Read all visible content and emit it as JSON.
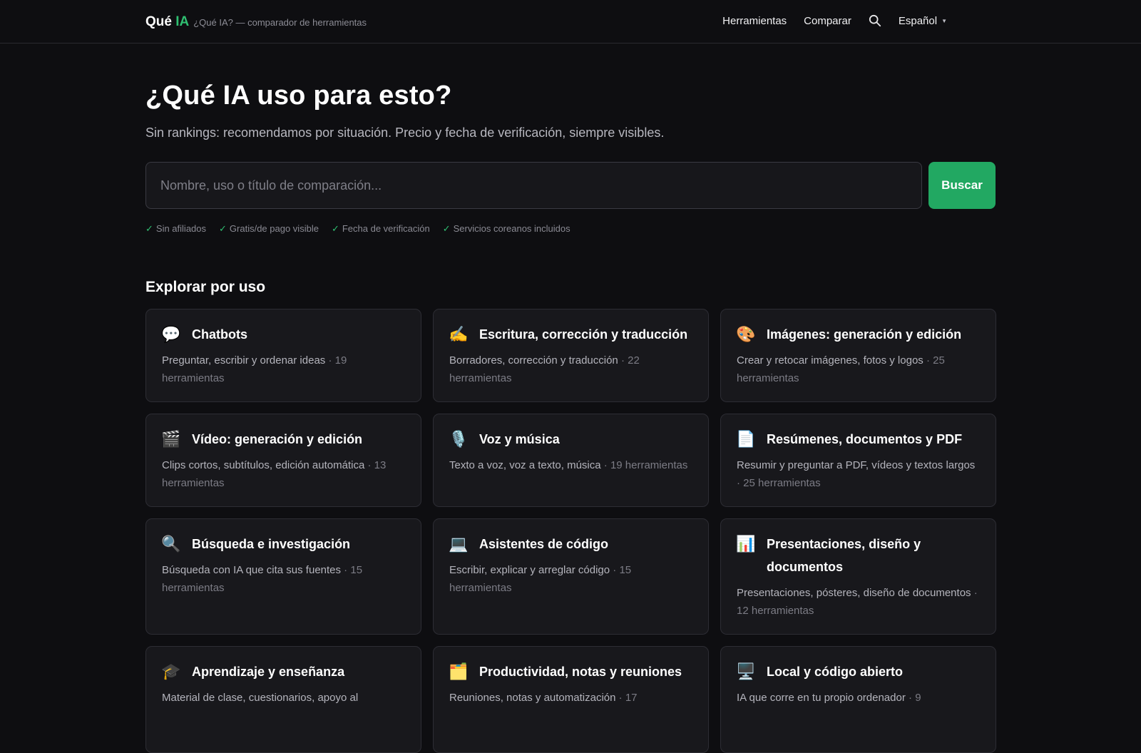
{
  "header": {
    "brand_prefix": "Qué",
    "brand_accent": "IA",
    "tagline": "¿Qué IA? — comparador de herramientas",
    "nav": {
      "tools": "Herramientas",
      "compare": "Comparar",
      "language": "Español"
    }
  },
  "hero": {
    "title": "¿Qué IA uso para esto?",
    "subtitle": "Sin rankings: recomendamos por situación. Precio y fecha de verificación, siempre visibles.",
    "search_placeholder": "Nombre, uso o título de comparación...",
    "search_button": "Buscar",
    "badges": [
      "Sin afiliados",
      "Gratis/de pago visible",
      "Fecha de verificación",
      "Servicios coreanos incluidos"
    ]
  },
  "section": {
    "title": "Explorar por uso"
  },
  "categories": [
    {
      "icon": "💬",
      "title": "Chatbots",
      "desc": "Preguntar, escribir y ordenar ideas",
      "count": "19 herramientas"
    },
    {
      "icon": "✍️",
      "title": "Escritura, corrección y traducción",
      "desc": "Borradores, corrección y traducción",
      "count": "22 herramientas"
    },
    {
      "icon": "🎨",
      "title": "Imágenes: generación y edición",
      "desc": "Crear y retocar imágenes, fotos y logos",
      "count": "25 herramientas"
    },
    {
      "icon": "🎬",
      "title": "Vídeo: generación y edición",
      "desc": "Clips cortos, subtítulos, edición automática",
      "count": "13 herramientas"
    },
    {
      "icon": "🎙️",
      "title": "Voz y música",
      "desc": "Texto a voz, voz a texto, música",
      "count": "19 herramientas"
    },
    {
      "icon": "📄",
      "title": "Resúmenes, documentos y PDF",
      "desc": "Resumir y preguntar a PDF, vídeos y textos largos",
      "count": "25 herramientas"
    },
    {
      "icon": "🔍",
      "title": "Búsqueda e investigación",
      "desc": "Búsqueda con IA que cita sus fuentes",
      "count": "15 herramientas"
    },
    {
      "icon": "💻",
      "title": "Asistentes de código",
      "desc": "Escribir, explicar y arreglar código",
      "count": "15 herramientas"
    },
    {
      "icon": "📊",
      "title": "Presentaciones, diseño y documentos",
      "desc": "Presentaciones, pósteres, diseño de documentos",
      "count": "12 herramientas"
    },
    {
      "icon": "🎓",
      "title": "Aprendizaje y enseñanza",
      "desc": "Material de clase, cuestionarios, apoyo al",
      "count": ""
    },
    {
      "icon": "🗂️",
      "title": "Productividad, notas y reuniones",
      "desc": "Reuniones, notas y automatización",
      "count": "17"
    },
    {
      "icon": "🖥️",
      "title": "Local y código abierto",
      "desc": "IA que corre en tu propio ordenador",
      "count": "9"
    }
  ]
}
